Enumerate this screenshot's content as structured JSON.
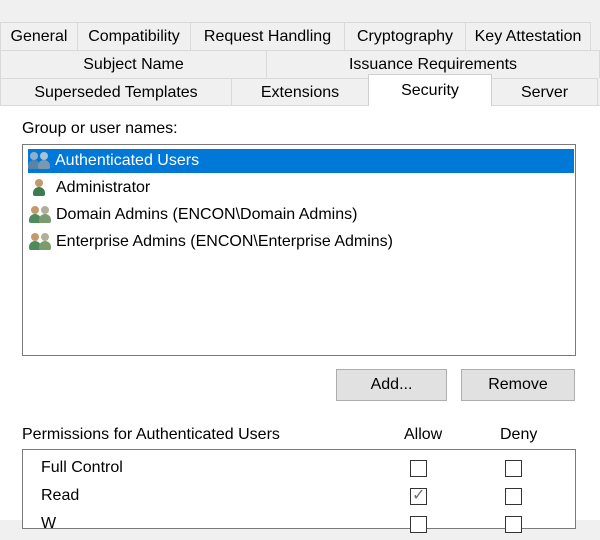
{
  "tabs": {
    "row1": [
      "General",
      "Compatibility",
      "Request Handling",
      "Cryptography",
      "Key Attestation"
    ],
    "row2": [
      "Subject Name",
      "Issuance Requirements"
    ],
    "row3": [
      "Superseded Templates",
      "Extensions",
      "Security",
      "Server"
    ],
    "active": "Security"
  },
  "group_label": "Group or user names:",
  "users": [
    {
      "name": "Authenticated Users",
      "selected": true,
      "icon": "group-icon"
    },
    {
      "name": "Administrator",
      "selected": false,
      "icon": "user-icon"
    },
    {
      "name": "Domain Admins (ENCON\\Domain Admins)",
      "selected": false,
      "icon": "group-icon"
    },
    {
      "name": "Enterprise Admins (ENCON\\Enterprise Admins)",
      "selected": false,
      "icon": "group-icon"
    }
  ],
  "buttons": {
    "add": "Add...",
    "remove": "Remove"
  },
  "permissions": {
    "label": "Permissions for Authenticated Users",
    "allow_label": "Allow",
    "deny_label": "Deny",
    "rows": [
      {
        "name": "Full Control",
        "allow": false,
        "deny": false
      },
      {
        "name": "Read",
        "allow": true,
        "deny": false
      },
      {
        "name": "W",
        "allow": false,
        "deny": false
      }
    ]
  },
  "colors": {
    "selection": "#0078d7",
    "window": "#f0f0f0"
  }
}
